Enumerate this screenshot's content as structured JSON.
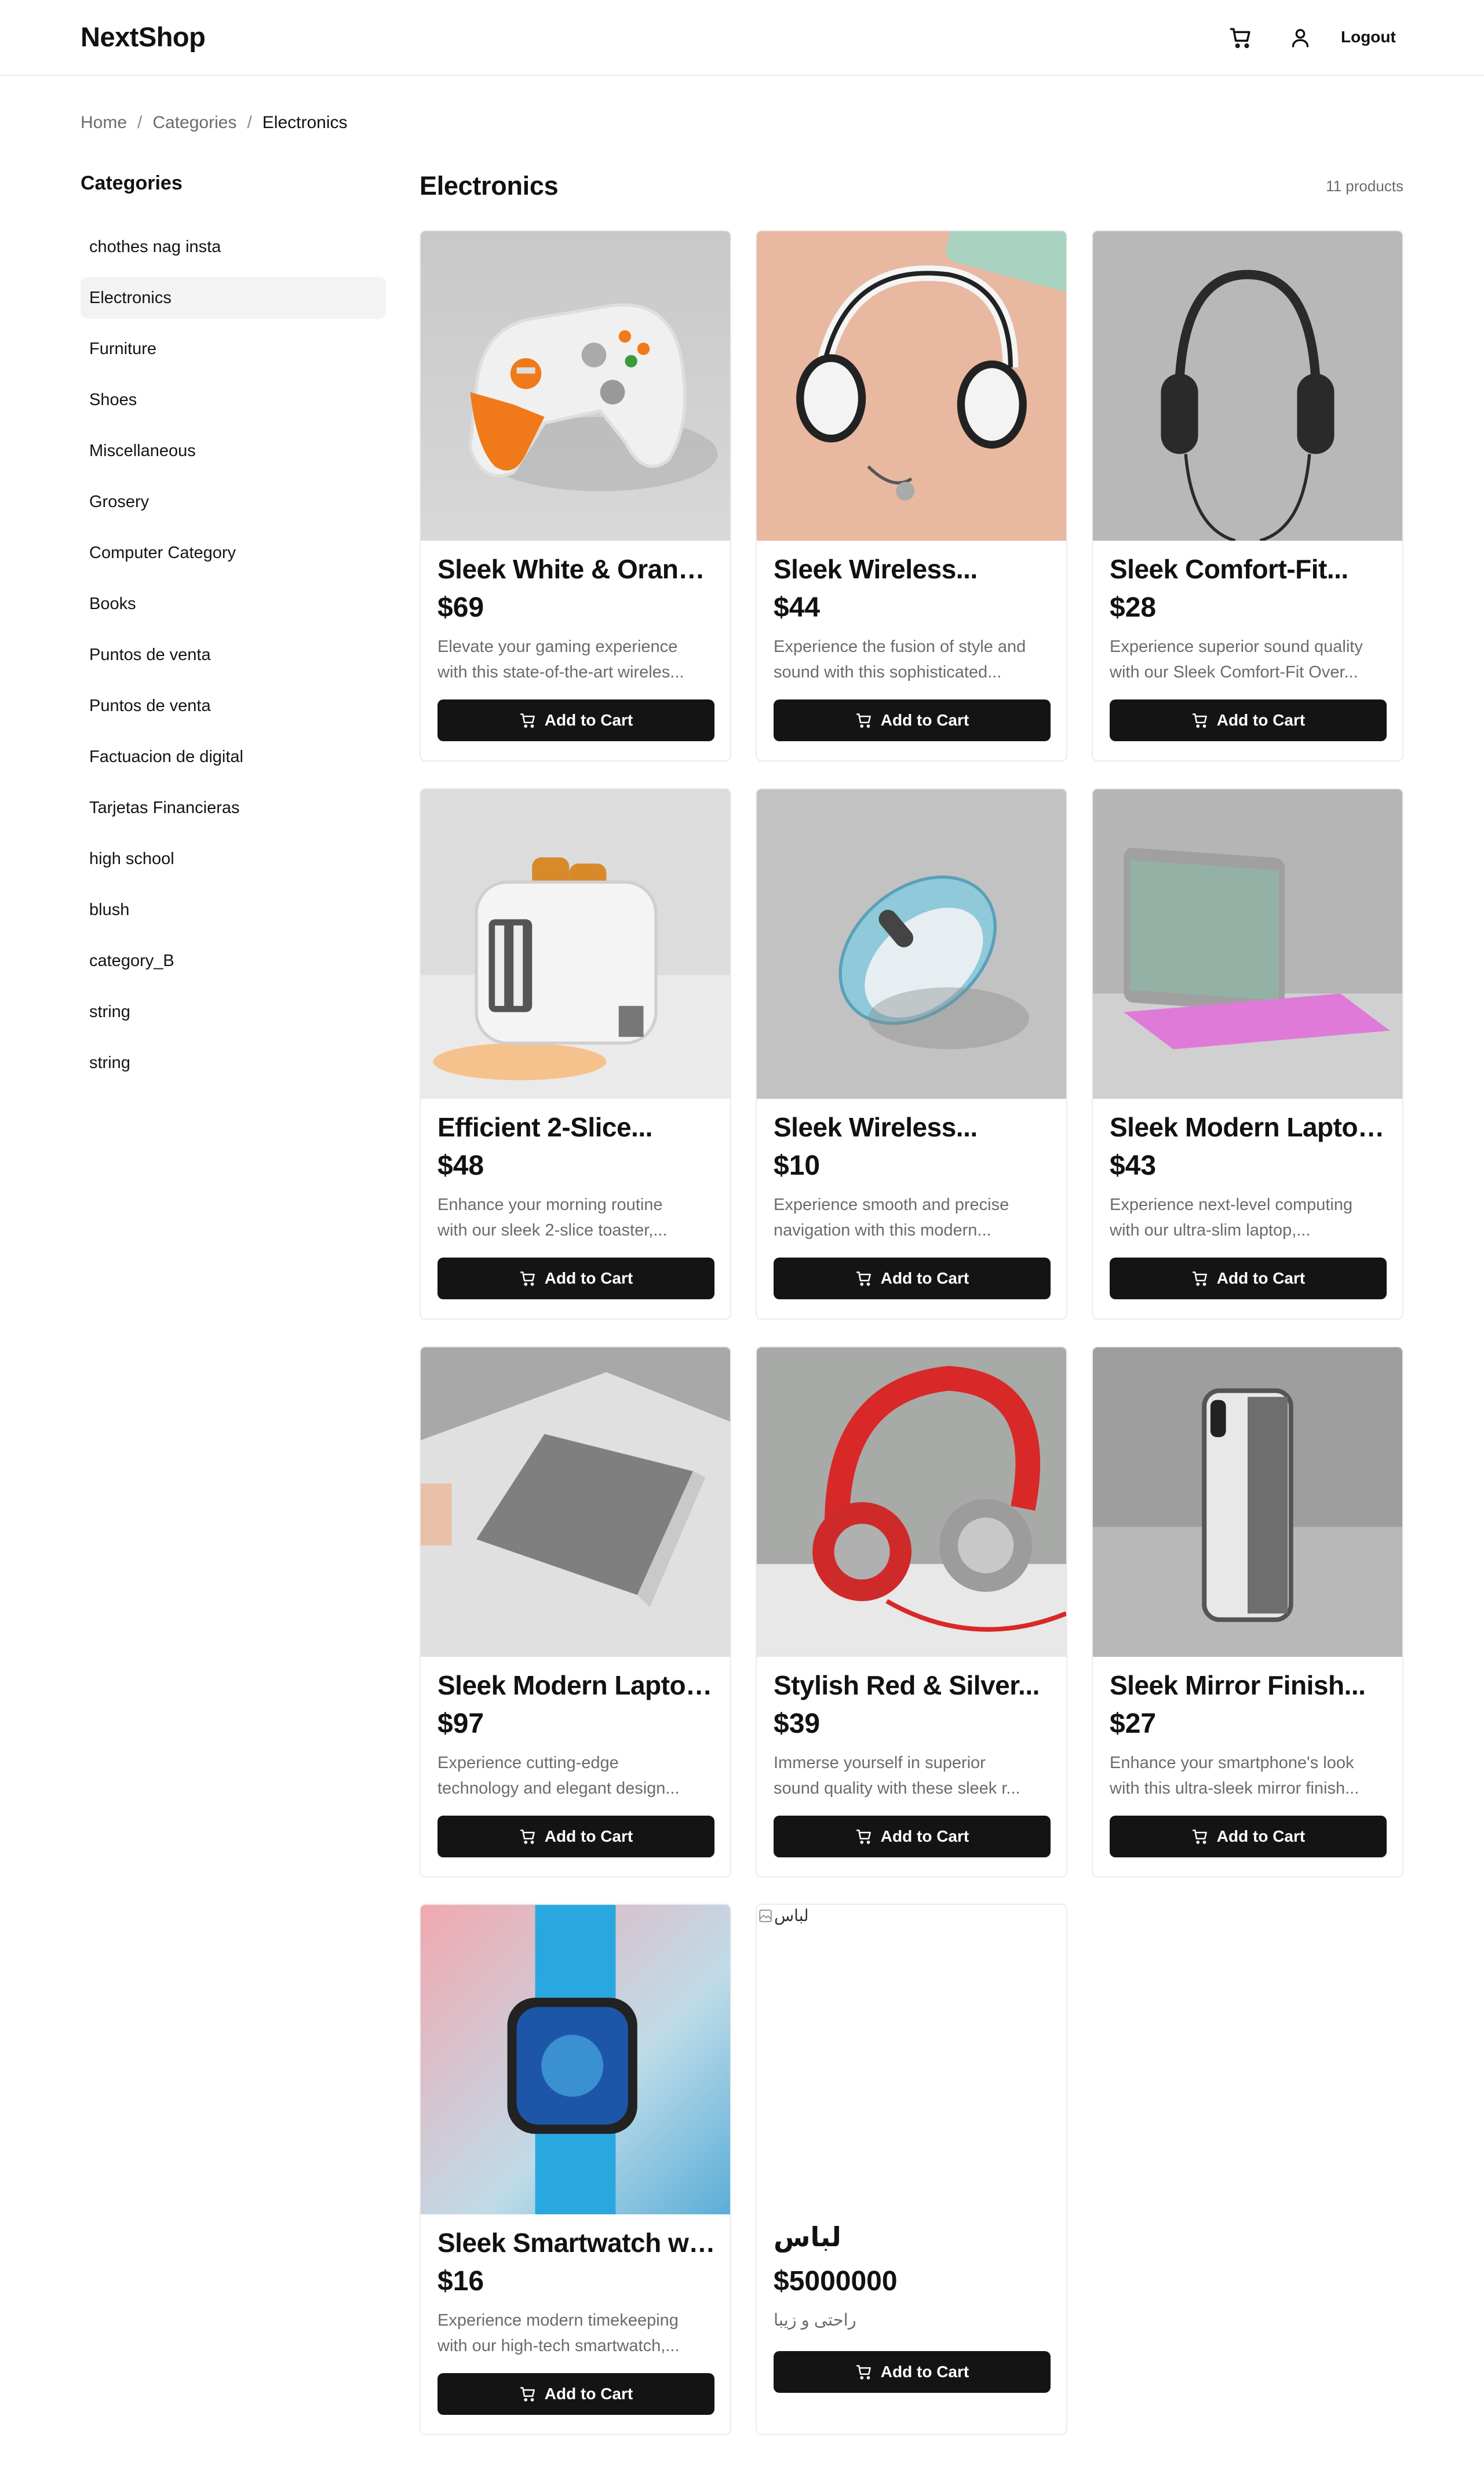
{
  "header": {
    "logo": "NextShop",
    "cart_icon": "cart-icon",
    "user_icon": "user-icon",
    "logout_label": "Logout"
  },
  "breadcrumb": [
    "Home",
    "Categories",
    "Electronics"
  ],
  "sidebar": {
    "title": "Categories",
    "items": [
      {
        "label": "chothes nag insta",
        "active": false
      },
      {
        "label": "Electronics",
        "active": true
      },
      {
        "label": "Furniture",
        "active": false
      },
      {
        "label": "Shoes",
        "active": false
      },
      {
        "label": "Miscellaneous",
        "active": false
      },
      {
        "label": "Grosery",
        "active": false
      },
      {
        "label": "Computer Category",
        "active": false
      },
      {
        "label": "Books",
        "active": false
      },
      {
        "label": "Puntos de venta",
        "active": false
      },
      {
        "label": "Puntos de venta",
        "active": false
      },
      {
        "label": "Factuacion de digital",
        "active": false
      },
      {
        "label": "Tarjetas Financieras",
        "active": false
      },
      {
        "label": "high school",
        "active": false
      },
      {
        "label": "blush",
        "active": false
      },
      {
        "label": "category_B",
        "active": false
      },
      {
        "label": "string",
        "active": false
      },
      {
        "label": "string",
        "active": false
      }
    ]
  },
  "main": {
    "title": "Electronics",
    "count": "11 products",
    "add_to_cart_label": "Add to Cart",
    "products": [
      {
        "title": "Sleek White & Orange...",
        "price": "$69",
        "desc1": "Elevate your gaming experience",
        "desc2": "with this state-of-the-art wireles...",
        "image": "game-controller"
      },
      {
        "title": "Sleek Wireless...",
        "price": "$44",
        "desc1": "Experience the fusion of style and",
        "desc2": "sound with this sophisticated...",
        "image": "white-headphones"
      },
      {
        "title": "Sleek Comfort-Fit...",
        "price": "$28",
        "desc1": "Experience superior sound quality",
        "desc2": "with our Sleek Comfort-Fit Over...",
        "image": "black-headphones"
      },
      {
        "title": "Efficient 2-Slice...",
        "price": "$48",
        "desc1": "Enhance your morning routine",
        "desc2": "with our sleek 2-slice toaster,...",
        "image": "toaster"
      },
      {
        "title": "Sleek Wireless...",
        "price": "$10",
        "desc1": "Experience smooth and precise",
        "desc2": "navigation with this modern...",
        "image": "wireless-mouse"
      },
      {
        "title": "Sleek Modern Laptop...",
        "price": "$43",
        "desc1": "Experience next-level computing",
        "desc2": "with our ultra-slim laptop,...",
        "image": "laptop-pink"
      },
      {
        "title": "Sleek Modern Laptop...",
        "price": "$97",
        "desc1": "Experience cutting-edge",
        "desc2": "technology and elegant design...",
        "image": "laptop-silver"
      },
      {
        "title": "Stylish Red & Silver...",
        "price": "$39",
        "desc1": "Immerse yourself in superior",
        "desc2": "sound quality with these sleek r...",
        "image": "red-headphones"
      },
      {
        "title": "Sleek Mirror Finish...",
        "price": "$27",
        "desc1": "Enhance your smartphone's look",
        "desc2": "with this ultra-sleek mirror finish...",
        "image": "phone-case"
      },
      {
        "title": "Sleek Smartwatch wi...",
        "price": "$16",
        "desc1": "Experience modern timekeeping",
        "desc2": "with our high-tech smartwatch,...",
        "image": "smartwatch"
      },
      {
        "title": "لباس",
        "price": "$5000000",
        "desc1": "راحتی و زیبا",
        "desc2": "",
        "image": "broken",
        "alt": "لباس"
      }
    ]
  },
  "colors": {
    "button_bg": "#141414",
    "active_bg": "#f3f3f3",
    "muted_text": "#6b6b6b",
    "border": "#ececec"
  }
}
